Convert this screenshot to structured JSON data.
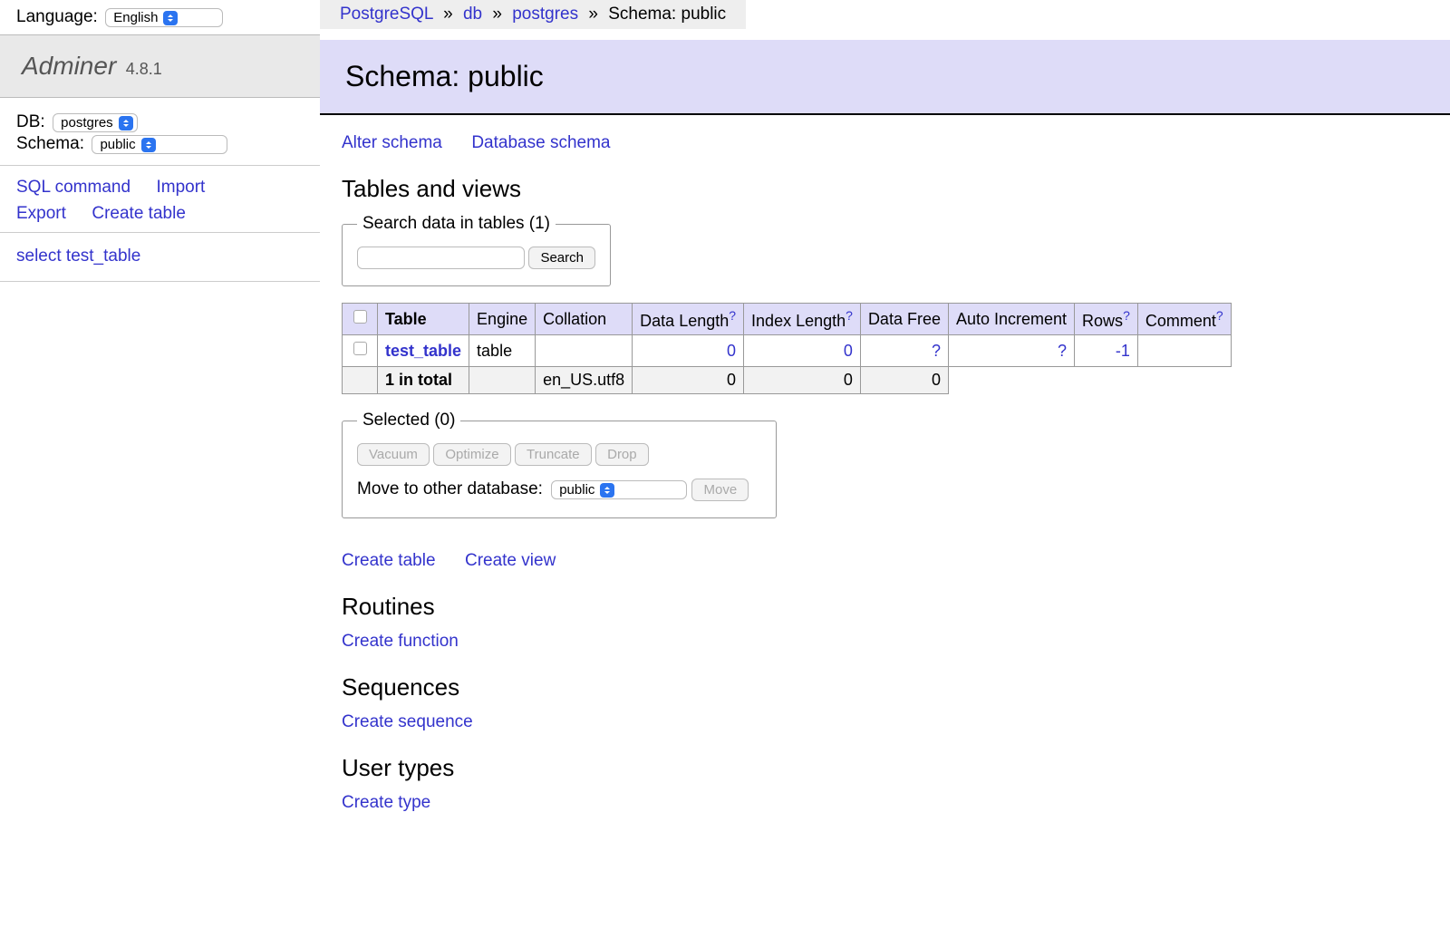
{
  "sidebar": {
    "language_label": "Language:",
    "language_value": "English",
    "app_name": "Adminer",
    "app_version": "4.8.1",
    "db_label": "DB:",
    "db_value": "postgres",
    "schema_label": "Schema:",
    "schema_value": "public",
    "links": {
      "sql": "SQL command",
      "import": "Import",
      "export": "Export",
      "create_table": "Create table"
    },
    "select_link": "select test_table"
  },
  "breadcrumbs": {
    "server": "PostgreSQL",
    "db_label": "db",
    "db_value": "postgres",
    "schema_prefix": "Schema: ",
    "schema_value": "public",
    "sep": "»"
  },
  "page_title": "Schema: public",
  "top_links": {
    "alter": "Alter schema",
    "db_schema": "Database schema"
  },
  "tables_heading": "Tables and views",
  "search": {
    "legend": "Search data in tables (1)",
    "button": "Search"
  },
  "table": {
    "headers": {
      "table": "Table",
      "engine": "Engine",
      "collation": "Collation",
      "data_length": "Data Length",
      "index_length": "Index Length",
      "data_free": "Data Free",
      "auto_increment": "Auto Increment",
      "rows": "Rows",
      "comment": "Comment"
    },
    "qmark": "?",
    "row": {
      "name": "test_table",
      "engine": "table",
      "collation": "",
      "data_length": "0",
      "index_length": "0",
      "data_free": "?",
      "auto_increment": "?",
      "rows": "-1",
      "comment": ""
    },
    "footer": {
      "label": "1 in total",
      "collation": "en_US.utf8",
      "data_length": "0",
      "index_length": "0",
      "data_free": "0"
    }
  },
  "selected": {
    "legend": "Selected (0)",
    "vacuum": "Vacuum",
    "optimize": "Optimize",
    "truncate": "Truncate",
    "drop": "Drop",
    "move_label": "Move to other database:",
    "move_target": "public",
    "move_button": "Move"
  },
  "bottom_links": {
    "create_table": "Create table",
    "create_view": "Create view"
  },
  "routines": {
    "heading": "Routines",
    "create": "Create function"
  },
  "sequences": {
    "heading": "Sequences",
    "create": "Create sequence"
  },
  "user_types": {
    "heading": "User types",
    "create": "Create type"
  }
}
